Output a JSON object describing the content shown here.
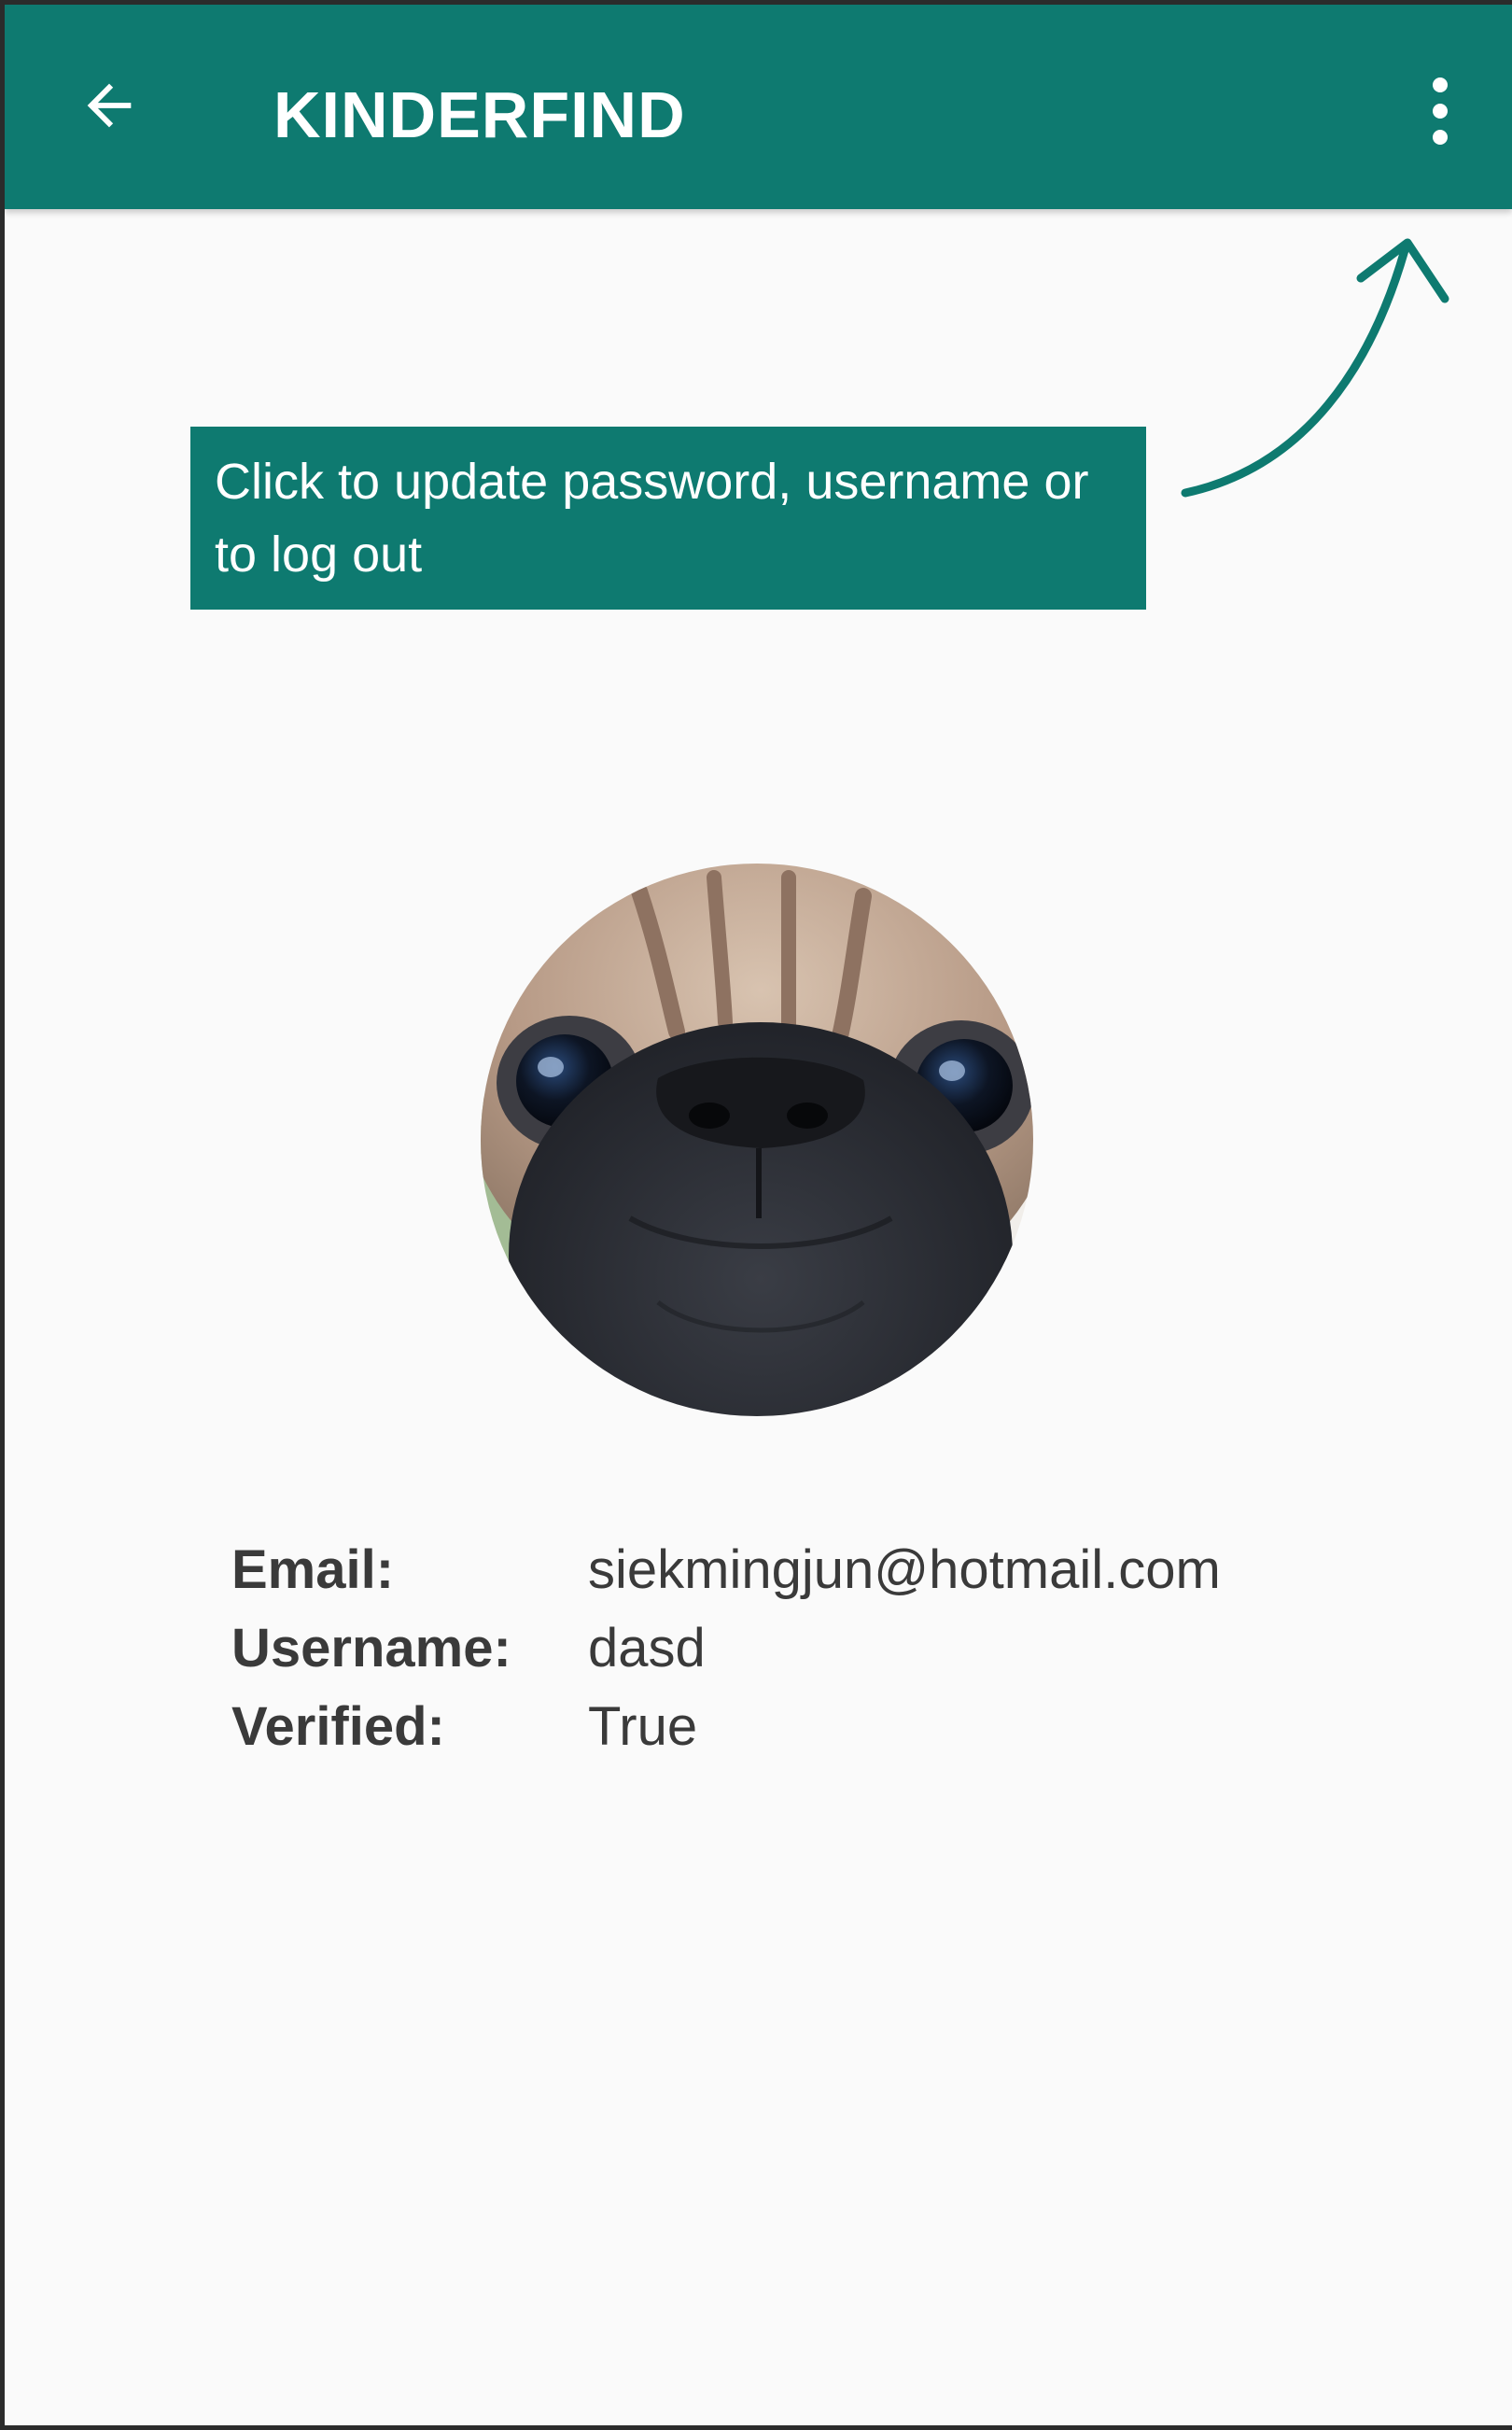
{
  "app_bar": {
    "title": "KINDERFIND",
    "background_color": "#0e7a70",
    "back_icon": "arrow-left-icon",
    "menu_icon": "more-vertical-icon"
  },
  "hint": {
    "text": "Click to update password, username or to log out",
    "arrow_icon": "curved-arrow-icon"
  },
  "profile": {
    "avatar_icon": "pug-avatar",
    "fields": [
      {
        "label": "Email:",
        "value": "siekmingjun@hotmail.com"
      },
      {
        "label": "Username:",
        "value": "dasd"
      },
      {
        "label": "Verified:",
        "value": "True"
      }
    ]
  }
}
